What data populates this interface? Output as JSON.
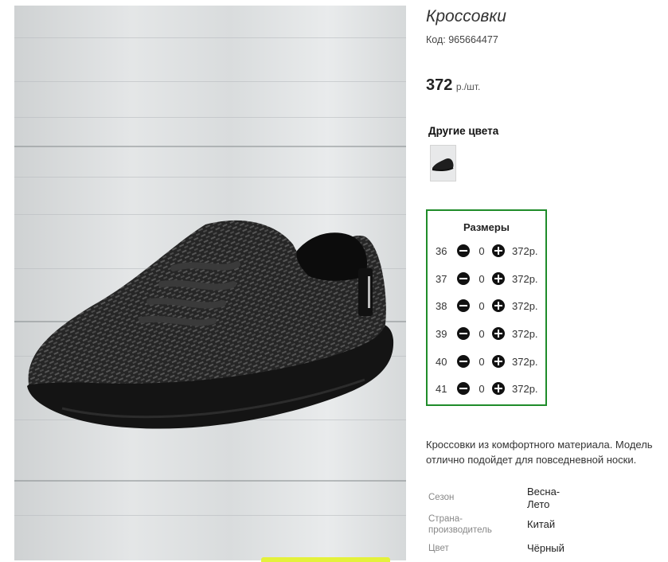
{
  "product": {
    "title": "Кроссовки",
    "code": "Код: 965664477",
    "price_amount": "372",
    "price_unit": "р./шт.",
    "image_alt": "black knit sneaker on white wooden boards"
  },
  "other_colors": {
    "title": "Другие цвета"
  },
  "sizes": {
    "title": "Размеры",
    "rows": [
      {
        "size": "36",
        "qty": "0",
        "price": "372р."
      },
      {
        "size": "37",
        "qty": "0",
        "price": "372р."
      },
      {
        "size": "38",
        "qty": "0",
        "price": "372р."
      },
      {
        "size": "39",
        "qty": "0",
        "price": "372р."
      },
      {
        "size": "40",
        "qty": "0",
        "price": "372р."
      },
      {
        "size": "41",
        "qty": "0",
        "price": "372р."
      }
    ]
  },
  "description": {
    "line1": "Кроссовки из комфортного материала. Модель",
    "line2": "отлично подойдет для повседневной носки."
  },
  "attributes": [
    {
      "label": "Сезон",
      "value_line1": "Весна-",
      "value_line2": "Лето"
    },
    {
      "label_line1": "Страна-",
      "label_line2": "производитель",
      "value": "Китай"
    },
    {
      "label": "Цвет",
      "value": "Чёрный"
    }
  ],
  "colors": {
    "sizes_border": "#1f8c2a",
    "promo_strip": "#e4f13b"
  },
  "icons": [
    "minus-circle-icon",
    "plus-circle-icon"
  ]
}
